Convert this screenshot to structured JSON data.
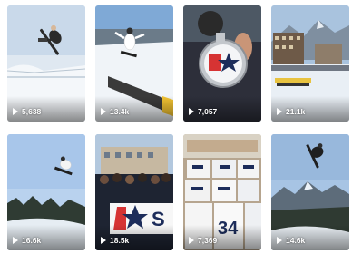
{
  "videos": [
    {
      "views": "5,638",
      "icon": "play-icon",
      "scene": "snowboarder jumping over halfpipe"
    },
    {
      "views": "13.4k",
      "icon": "play-icon",
      "scene": "snowboarder on rail"
    },
    {
      "views": "7,057",
      "icon": "play-icon",
      "scene": "medal held up to camera"
    },
    {
      "views": "21.1k",
      "icon": "play-icon",
      "scene": "mountain resort with crowd"
    },
    {
      "views": "16.6k",
      "icon": "play-icon",
      "scene": "snowboarder in air over trees"
    },
    {
      "views": "18.5k",
      "icon": "play-icon",
      "scene": "team group with flag"
    },
    {
      "views": "7,369",
      "icon": "play-icon",
      "scene": "race bibs laid out on table"
    },
    {
      "views": "14.6k",
      "icon": "play-icon",
      "scene": "snowboarder flipping over mountains"
    }
  ],
  "flag_text": "S",
  "bib_numbers": [
    "34"
  ],
  "colors": {
    "sky": "#9fc6ec",
    "snow": "#eef3f8",
    "navy": "#1c2c5a",
    "flag_red": "#d63333"
  }
}
